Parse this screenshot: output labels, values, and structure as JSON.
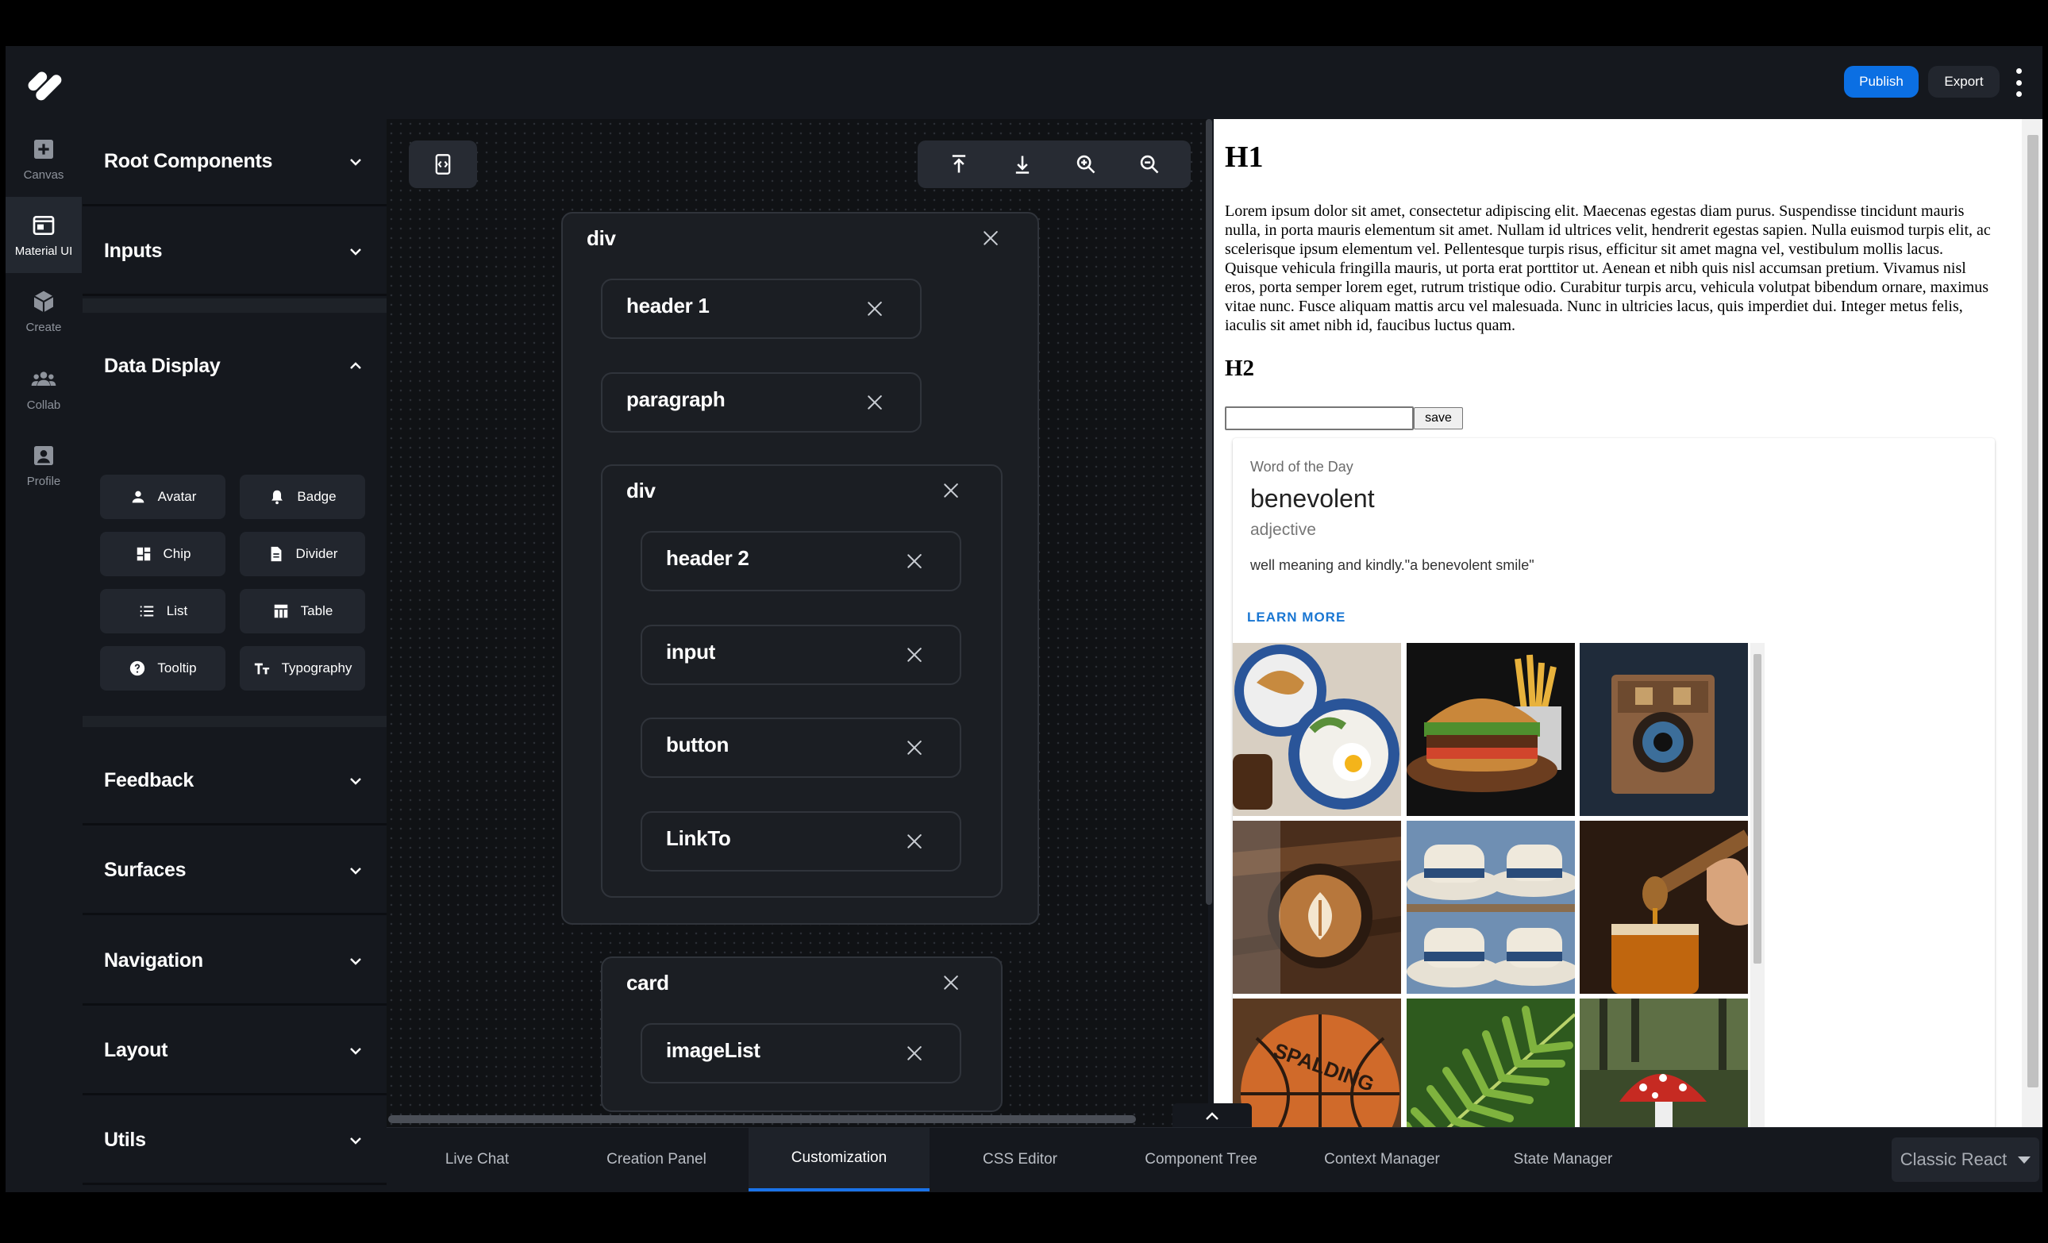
{
  "header": {
    "publish_label": "Publish",
    "export_label": "Export"
  },
  "rail": [
    {
      "label": "Canvas",
      "icon": "plus-square-icon"
    },
    {
      "label": "Material UI",
      "icon": "window-icon"
    },
    {
      "label": "Create",
      "icon": "cube-icon"
    },
    {
      "label": "Collab",
      "icon": "people-icon"
    },
    {
      "label": "Profile",
      "icon": "account-box-icon"
    }
  ],
  "sections": {
    "root": "Root Components",
    "inputs": "Inputs",
    "data_display": "Data Display",
    "feedback": "Feedback",
    "surfaces": "Surfaces",
    "navigation": "Navigation",
    "layout": "Layout",
    "utils": "Utils"
  },
  "components": {
    "avatar": "Avatar",
    "badge": "Badge",
    "chip": "Chip",
    "divider": "Divider",
    "list": "List",
    "table": "Table",
    "tooltip": "Tooltip",
    "typography": "Typography"
  },
  "tree": {
    "div1": "div",
    "header1": "header 1",
    "paragraph": "paragraph",
    "div2": "div",
    "header2": "header 2",
    "input": "input",
    "button": "button",
    "linkto": "LinkTo",
    "card": "card",
    "imagelist": "imageList"
  },
  "preview": {
    "h1": "H1",
    "paragraph": "Lorem ipsum dolor sit amet, consectetur adipiscing elit. Maecenas egestas diam purus. Suspendisse tincidunt mauris nulla, in porta mauris elementum sit amet. Nullam id ultrices velit, hendrerit egestas sapien. Nulla euismod turpis elit, ac scelerisque ipsum elementum vel. Pellentesque turpis risus, efficitur sit amet magna vel, vestibulum mollis lacus. Quisque vehicula fringilla mauris, ut porta erat porttitor ut. Aenean et nibh quis nisl accumsan pretium. Vivamus nisl eros, porta semper lorem eget, rutrum tristique odio. Curabitur turpis arcu, vehicula volutpat bibendum ornare, maximus vitae nunc. Fusce aliquam mattis arcu vel malesuada. Nunc in ultricies lacus, quis imperdiet dui. Integer metus felis, iaculis sit amet nibh id, faucibus luctus quam.",
    "h2": "H2",
    "input_value": "",
    "save_label": "save",
    "card": {
      "overline": "Word of the Day",
      "word": "benevolent",
      "pos": "adjective",
      "definition": "well meaning and kindly.\"a benevolent smile\"",
      "action": "LEARN MORE"
    },
    "images": [
      "breakfast",
      "burger",
      "camera",
      "coffee",
      "hats",
      "honey",
      "basketball",
      "fern",
      "mushroom"
    ],
    "basketball_text": "SPALDING"
  },
  "tabs": [
    "Live Chat",
    "Creation Panel",
    "Customization",
    "CSS Editor",
    "Component Tree",
    "Context Manager",
    "State Manager"
  ],
  "active_tab": "Customization",
  "framework": "Classic React"
}
